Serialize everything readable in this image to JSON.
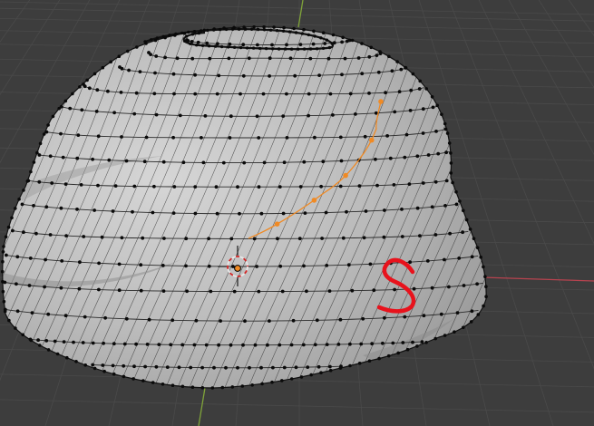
{
  "viewport": {
    "colors": {
      "background": "#3d3d3d",
      "grid": "#4a4a4a",
      "x_axis": "#b8434f",
      "y_axis": "#7fa33a",
      "mesh_fill": "#b9b9b9",
      "mesh_edge": "#2a2a2a",
      "vertex": "#0a0a0a",
      "selected": "#f08a24",
      "annotation": "#e8121c"
    },
    "cursor": {
      "icon": "3d-cursor-icon"
    },
    "origin": {
      "icon": "object-origin-icon"
    },
    "annotation": {
      "icon": "hand-drawn-s-annotation"
    }
  }
}
